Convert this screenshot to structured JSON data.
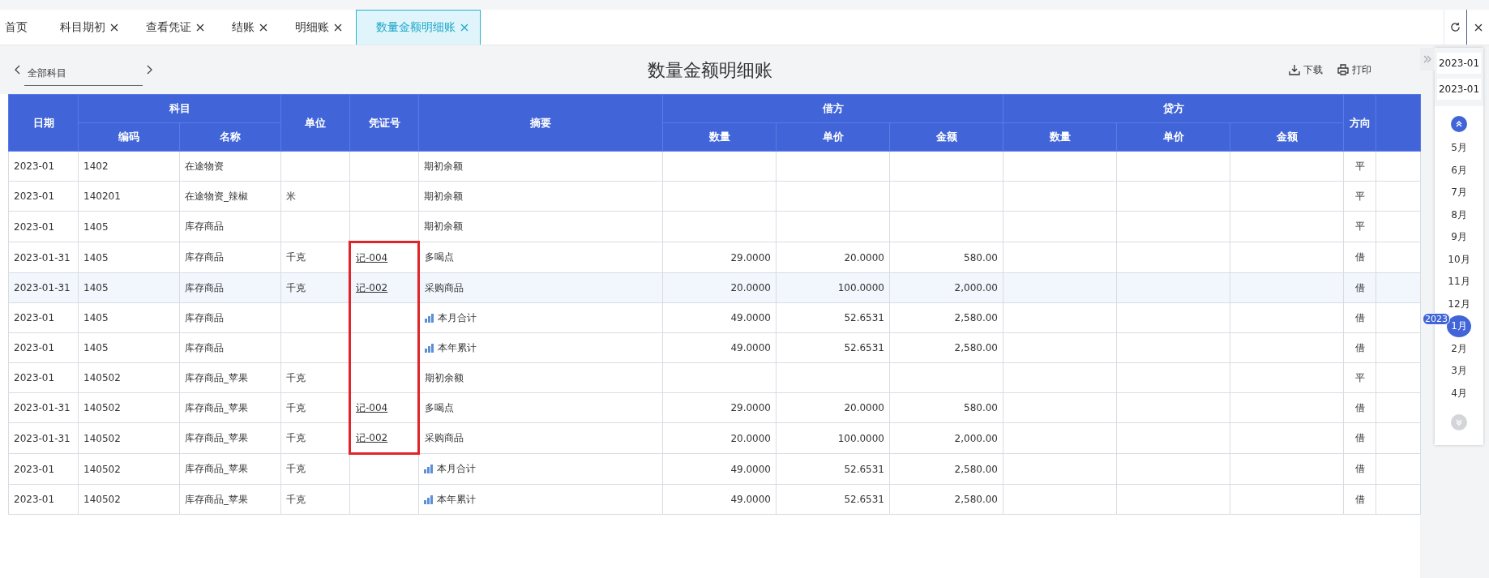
{
  "tabs": [
    {
      "label": "首页",
      "closable": false,
      "selected": false
    },
    {
      "label": "科目期初",
      "closable": true,
      "selected": false
    },
    {
      "label": "查看凭证",
      "closable": true,
      "selected": false
    },
    {
      "label": "结账",
      "closable": true,
      "selected": false
    },
    {
      "label": "明细账",
      "closable": true,
      "selected": false
    },
    {
      "label": "数量金额明细账",
      "closable": true,
      "selected": true
    }
  ],
  "toolbar": {
    "subject_select": "全部科目",
    "title": "数量金额明细账",
    "actions": [
      {
        "kind": "download",
        "label": "下载"
      },
      {
        "kind": "print",
        "label": "打印"
      }
    ]
  },
  "table": {
    "header": {
      "date": "日期",
      "subject": "科目",
      "code": "编码",
      "name": "名称",
      "unit": "单位",
      "voucher": "凭证号",
      "summary": "摘要",
      "debit": "借方",
      "credit": "贷方",
      "qty": "数量",
      "price": "单价",
      "amount": "金额",
      "credit_qty": "数量",
      "credit_price": "单价",
      "credit_amount": "金额",
      "direction": "方向"
    },
    "rows": [
      {
        "date": "2023-01",
        "code": "1402",
        "name": "在途物资",
        "unit": "",
        "voucher": "",
        "kind": "plain",
        "summary": "期初余额",
        "qty": "",
        "price": "",
        "amount": "",
        "direction": "平",
        "hovered": false,
        "framed": false
      },
      {
        "date": "2023-01",
        "code": "140201",
        "name": "在途物资_辣椒",
        "unit": "米",
        "voucher": "",
        "kind": "plain",
        "summary": "期初余额",
        "qty": "",
        "price": "",
        "amount": "",
        "direction": "平",
        "hovered": false,
        "framed": false
      },
      {
        "date": "2023-01",
        "code": "1405",
        "name": "库存商品",
        "unit": "",
        "voucher": "",
        "kind": "plain",
        "summary": "期初余额",
        "qty": "",
        "price": "",
        "amount": "",
        "direction": "平",
        "hovered": false,
        "framed": false
      },
      {
        "date": "2023-01-31",
        "code": "1405",
        "name": "库存商品",
        "unit": "千克",
        "voucher": "记-004",
        "kind": "plain",
        "summary": "多喝点",
        "qty": "29.0000",
        "price": "20.0000",
        "amount": "580.00",
        "direction": "借",
        "hovered": false,
        "framed": true
      },
      {
        "date": "2023-01-31",
        "code": "1405",
        "name": "库存商品",
        "unit": "千克",
        "voucher": "记-002",
        "kind": "plain",
        "summary": "采购商品",
        "qty": "20.0000",
        "price": "100.0000",
        "amount": "2,000.00",
        "direction": "借",
        "hovered": true,
        "framed": true
      },
      {
        "date": "2023-01",
        "code": "1405",
        "name": "库存商品",
        "unit": "",
        "voucher": "",
        "kind": "total",
        "summary": "本月合计",
        "qty": "49.0000",
        "price": "52.6531",
        "amount": "2,580.00",
        "direction": "借",
        "hovered": false,
        "framed": true
      },
      {
        "date": "2023-01",
        "code": "1405",
        "name": "库存商品",
        "unit": "",
        "voucher": "",
        "kind": "total",
        "summary": "本年累计",
        "qty": "49.0000",
        "price": "52.6531",
        "amount": "2,580.00",
        "direction": "借",
        "hovered": false,
        "framed": true
      },
      {
        "date": "2023-01",
        "code": "140502",
        "name": "库存商品_苹果",
        "unit": "千克",
        "voucher": "",
        "kind": "plain",
        "summary": "期初余额",
        "qty": "",
        "price": "",
        "amount": "",
        "direction": "平",
        "hovered": false,
        "framed": true
      },
      {
        "date": "2023-01-31",
        "code": "140502",
        "name": "库存商品_苹果",
        "unit": "千克",
        "voucher": "记-004",
        "kind": "plain",
        "summary": "多喝点",
        "qty": "29.0000",
        "price": "20.0000",
        "amount": "580.00",
        "direction": "借",
        "hovered": false,
        "framed": true
      },
      {
        "date": "2023-01-31",
        "code": "140502",
        "name": "库存商品_苹果",
        "unit": "千克",
        "voucher": "记-002",
        "kind": "plain",
        "summary": "采购商品",
        "qty": "20.0000",
        "price": "100.0000",
        "amount": "2,000.00",
        "direction": "借",
        "hovered": false,
        "framed": true
      },
      {
        "date": "2023-01",
        "code": "140502",
        "name": "库存商品_苹果",
        "unit": "千克",
        "voucher": "",
        "kind": "total",
        "summary": "本月合计",
        "qty": "49.0000",
        "price": "52.6531",
        "amount": "2,580.00",
        "direction": "借",
        "hovered": false,
        "framed": false
      },
      {
        "date": "2023-01",
        "code": "140502",
        "name": "库存商品_苹果",
        "unit": "千克",
        "voucher": "",
        "kind": "total",
        "summary": "本年累计",
        "qty": "49.0000",
        "price": "52.6531",
        "amount": "2,580.00",
        "direction": "借",
        "hovered": false,
        "framed": false
      }
    ]
  },
  "period_panel": {
    "start": "2023-01",
    "end": "2023-01",
    "up_enabled": true,
    "down_enabled": false,
    "months": [
      {
        "label": "5月",
        "selected": false
      },
      {
        "label": "6月",
        "selected": false
      },
      {
        "label": "7月",
        "selected": false
      },
      {
        "label": "8月",
        "selected": false
      },
      {
        "label": "9月",
        "selected": false
      },
      {
        "label": "10月",
        "selected": false
      },
      {
        "label": "11月",
        "selected": false
      },
      {
        "label": "12月",
        "selected": false
      },
      {
        "label": "1月",
        "selected": true,
        "year_badge": "2023"
      },
      {
        "label": "2月",
        "selected": false
      },
      {
        "label": "3月",
        "selected": false
      },
      {
        "label": "4月",
        "selected": false
      }
    ]
  }
}
